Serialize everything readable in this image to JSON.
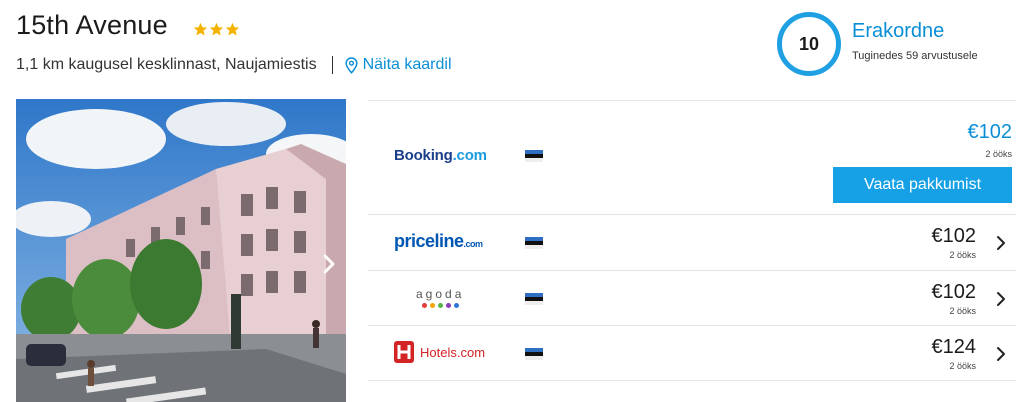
{
  "hotel": {
    "name": "15th Avenue",
    "stars": 3,
    "location": "1,1 km kaugusel kesklinnast, Naujamiestis",
    "map_link": "Näita kaardil"
  },
  "rating": {
    "score": "10",
    "label": "Erakordne",
    "reviews": "Tuginedes 59 arvustusele"
  },
  "colors": {
    "accent": "#1fa0e3",
    "link": "#0a8fd6",
    "star": "#f5b301"
  },
  "offers": [
    {
      "provider": "Booking.com",
      "logo_main": "Booking",
      "logo_suffix": ".com",
      "price": "€102",
      "nights": "2 ööks",
      "button": "Vaata pakkumist"
    },
    {
      "provider": "priceline.com",
      "logo_main": "priceline",
      "logo_suffix": ".com",
      "price": "€102",
      "nights": "2 ööks"
    },
    {
      "provider": "agoda",
      "logo_main": "agoda",
      "price": "€102",
      "nights": "2 ööks"
    },
    {
      "provider": "Hotels.com",
      "logo_main": "Hotels.com",
      "price": "€124",
      "nights": "2 ööks"
    }
  ]
}
